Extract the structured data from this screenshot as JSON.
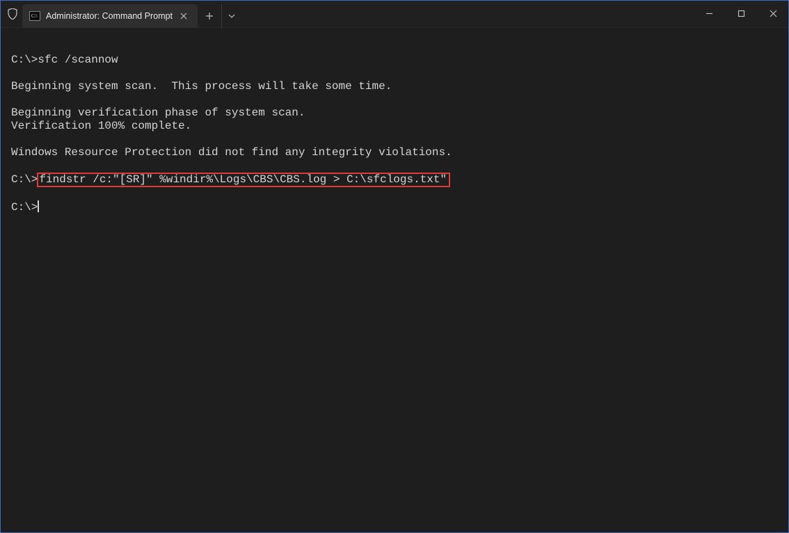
{
  "window": {
    "shield_icon": "shield",
    "minimize": "—",
    "maximize": "▢",
    "close": "✕"
  },
  "tab": {
    "label": "Administrator: Command Prompt",
    "icon": "cmd-icon"
  },
  "terminal": {
    "lines": [
      "",
      "C:\\>sfc /scannow",
      "",
      "Beginning system scan.  This process will take some time.",
      "",
      "Beginning verification phase of system scan.",
      "Verification 100% complete.",
      "",
      "Windows Resource Protection did not find any integrity violations.",
      "",
      "",
      "",
      "C:\\>"
    ],
    "highlight_prefix": "C:\\>",
    "highlight_command": "findstr /c:\"[SR]\" %windir%\\Logs\\CBS\\CBS.log > C:\\sfclogs.txt\""
  }
}
